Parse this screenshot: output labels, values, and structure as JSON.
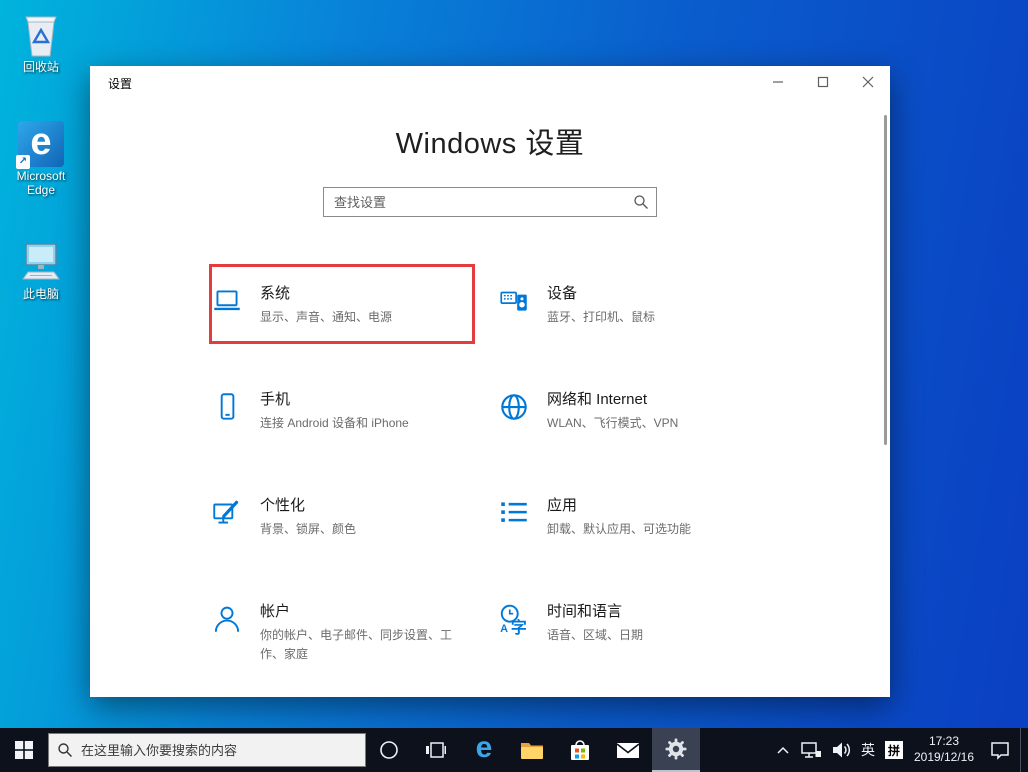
{
  "desktop": {
    "icons": [
      {
        "label": "回收站"
      },
      {
        "label": "Microsoft Edge"
      },
      {
        "label": "此电脑"
      }
    ]
  },
  "window": {
    "title": "设置",
    "heading": "Windows 设置",
    "search_placeholder": "查找设置",
    "accent": "#0078d7",
    "highlight_color": "#e23c3c",
    "categories": [
      {
        "title": "系统",
        "subtitle": "显示、声音、通知、电源"
      },
      {
        "title": "设备",
        "subtitle": "蓝牙、打印机、鼠标"
      },
      {
        "title": "手机",
        "subtitle": "连接 Android 设备和 iPhone"
      },
      {
        "title": "网络和 Internet",
        "subtitle": "WLAN、飞行模式、VPN"
      },
      {
        "title": "个性化",
        "subtitle": "背景、锁屏、颜色"
      },
      {
        "title": "应用",
        "subtitle": "卸载、默认应用、可选功能"
      },
      {
        "title": "帐户",
        "subtitle": "你的帐户、电子邮件、同步设置、工作、家庭"
      },
      {
        "title": "时间和语言",
        "subtitle": "语音、区域、日期"
      }
    ]
  },
  "taskbar": {
    "search_placeholder": "在这里输入你要搜索的内容",
    "tray": {
      "ime_lang": "英",
      "ime_mode": "拼",
      "time": "17:23",
      "date": "2019/12/16"
    }
  }
}
